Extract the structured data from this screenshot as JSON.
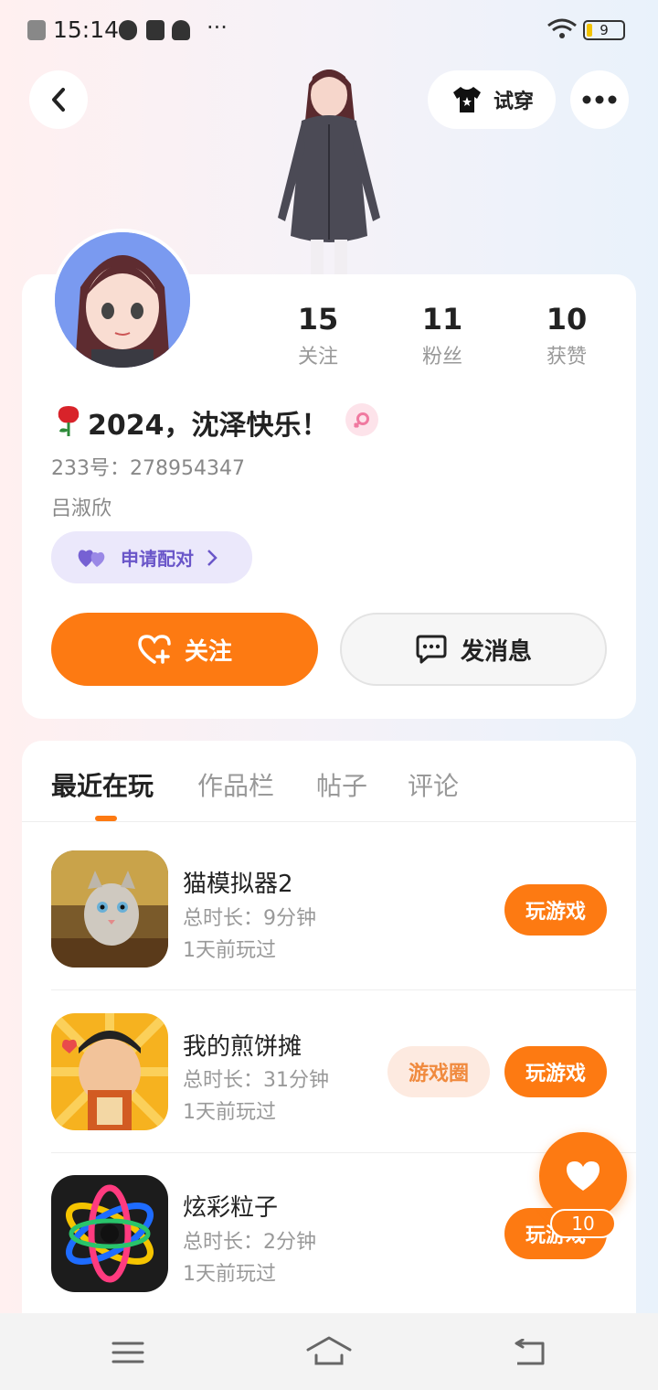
{
  "status": {
    "time": "15:14",
    "battery": "9",
    "dots": "···"
  },
  "header": {
    "try_on_label": "试穿"
  },
  "profile": {
    "name": "2024，沈泽快乐！",
    "id_label": "233号：",
    "id_value": "278954347",
    "real_name": "吕淑欣",
    "pair_label": "申请配对",
    "stats": [
      {
        "value": "15",
        "label": "关注"
      },
      {
        "value": "11",
        "label": "粉丝"
      },
      {
        "value": "10",
        "label": "获赞"
      }
    ],
    "follow_label": "关注",
    "message_label": "发消息"
  },
  "tabs": [
    {
      "label": "最近在玩",
      "active": true
    },
    {
      "label": "作品栏",
      "active": false
    },
    {
      "label": "帖子",
      "active": false
    },
    {
      "label": "评论",
      "active": false
    }
  ],
  "games": [
    {
      "title": "猫模拟器2",
      "duration": "总时长：9分钟",
      "last_played": "1天前玩过",
      "play_label": "玩游戏"
    },
    {
      "title": "我的煎饼摊",
      "duration": "总时长：31分钟",
      "last_played": "1天前玩过",
      "play_label": "玩游戏",
      "circle_label": "游戏圈"
    },
    {
      "title": "炫彩粒子",
      "duration": "总时长：2分钟",
      "last_played": "1天前玩过",
      "play_label": "玩游戏"
    }
  ],
  "like_fab": {
    "count": "10"
  },
  "colors": {
    "accent": "#fd7a12",
    "pair_bg": "#ebe8fb",
    "pair_text": "#6a56c9"
  }
}
